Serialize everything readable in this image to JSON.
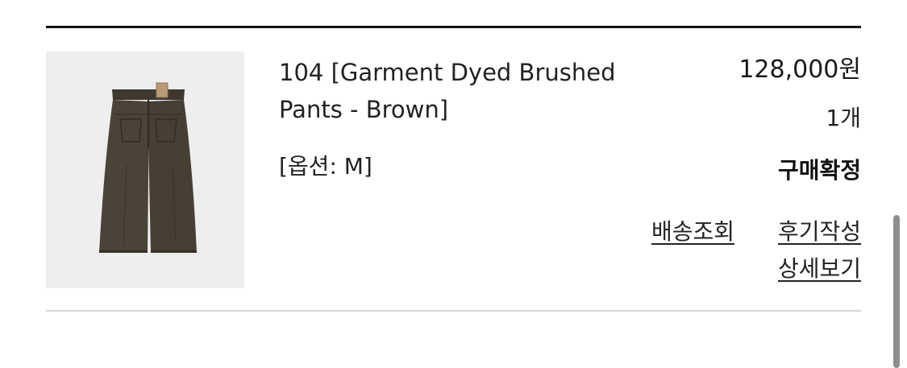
{
  "order_item": {
    "product_name": "104 [Garment Dyed Brushed Pants - Brown]",
    "option": "[옵션: M]",
    "price": "128,000원",
    "quantity": "1개",
    "status": "구매확정",
    "actions": {
      "tracking": "배송조회",
      "write_review": "후기작성",
      "view_details": "상세보기"
    },
    "image_icon": "brown-pants-photo"
  },
  "colors": {
    "top_rule": "#141414",
    "bottom_rule": "#d6d6d6",
    "thumbnail_bg": "#eeeeee",
    "product_color": "#4a4337"
  }
}
